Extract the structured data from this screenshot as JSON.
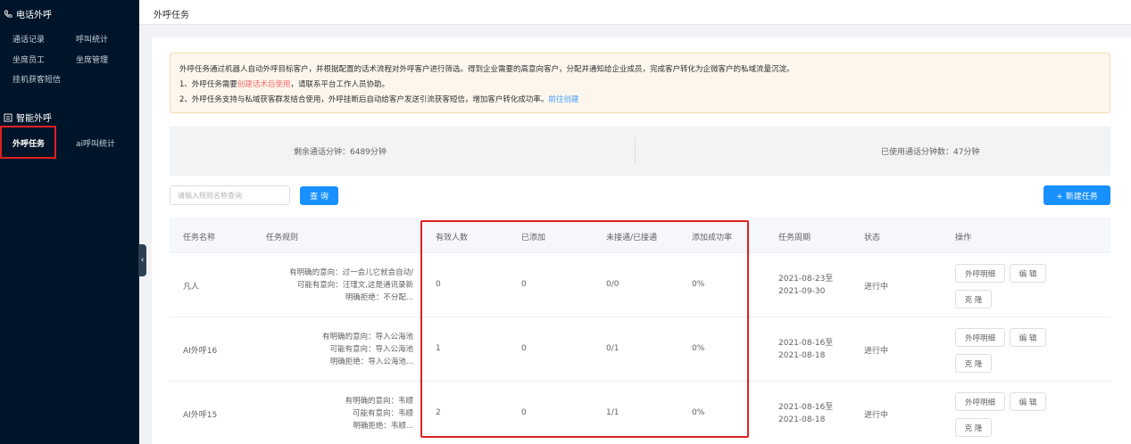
{
  "sidebar": {
    "groups": [
      {
        "title": "电话外呼",
        "icon": "phone-icon",
        "items": [
          "通话记录",
          "呼叫统计",
          "坐席员工",
          "坐席管理",
          "挂机获客短信"
        ]
      },
      {
        "title": "智能外呼",
        "icon": "robot-icon",
        "items": [
          "外呼任务",
          "ai呼叫统计"
        ]
      }
    ],
    "active_item": "外呼任务"
  },
  "header": {
    "title": "外呼任务"
  },
  "notice": {
    "line1": "外呼任务通过机器人自动外呼目标客户，并根据配置的话术流程对外呼客户进行筛选。得到企业需要的高意向客户，分配并通知给企业成员，完成客户转化为企微客户的私域流量沉淀。",
    "line2_prefix": "1、外呼任务需要",
    "line2_red": "创建话术后使用",
    "line2_suffix": "，请联系平台工作人员协助。",
    "line3_prefix": "2、外呼任务支持与私域获客群发结合使用，外呼挂断后自动给客户发送引流获客短信，增加客户转化成功率。",
    "line3_link": "前往创建"
  },
  "stats": {
    "remaining": "剩余通话分钟：6489分钟",
    "used": "已使用通话分钟数：47分钟"
  },
  "toolbar": {
    "search_placeholder": "请输入规则名称查询",
    "search_label": "查 询",
    "new_label": "+ 新建任务"
  },
  "table": {
    "columns": [
      "任务名称",
      "任务规则",
      "有效人数",
      "已添加",
      "未接通/已接通",
      "添加成功率",
      "任务周期",
      "状态",
      "操作"
    ],
    "rows": [
      {
        "name": "凡人",
        "rules": [
          "有明确的意向：过一会儿它就会自动/",
          "可能有意向：汪瑾文,这是通讯录新",
          "明确拒绝：不分配..."
        ],
        "valid": "0",
        "added": "0",
        "connect": "0/0",
        "rate": "0%",
        "period_start": "2021-08-23至",
        "period_end": "2021-09-30",
        "status": "进行中"
      },
      {
        "name": "AI外呼16",
        "rules": [
          "有明确的意向：导入公海池",
          "可能有意向：导入公海池",
          "明确拒绝：导入公海池..."
        ],
        "valid": "1",
        "added": "0",
        "connect": "0/1",
        "rate": "0%",
        "period_start": "2021-08-16至",
        "period_end": "2021-08-18",
        "status": "进行中"
      },
      {
        "name": "AI外呼15",
        "rules": [
          "有明确的意向：韦顺",
          "可能有意向：韦顺",
          "明确拒绝：韦顺..."
        ],
        "valid": "2",
        "added": "0",
        "connect": "1/1",
        "rate": "0%",
        "period_start": "2021-08-16至",
        "period_end": "2021-08-18",
        "status": "进行中"
      }
    ],
    "actions": {
      "detail": "外呼明细",
      "edit": "编 辑",
      "clone": "克 隆"
    }
  },
  "colors": {
    "sidebar_bg": "#001529",
    "primary": "#1890ff",
    "highlight": "#e02020",
    "notice_bg": "#fdf6ec"
  }
}
